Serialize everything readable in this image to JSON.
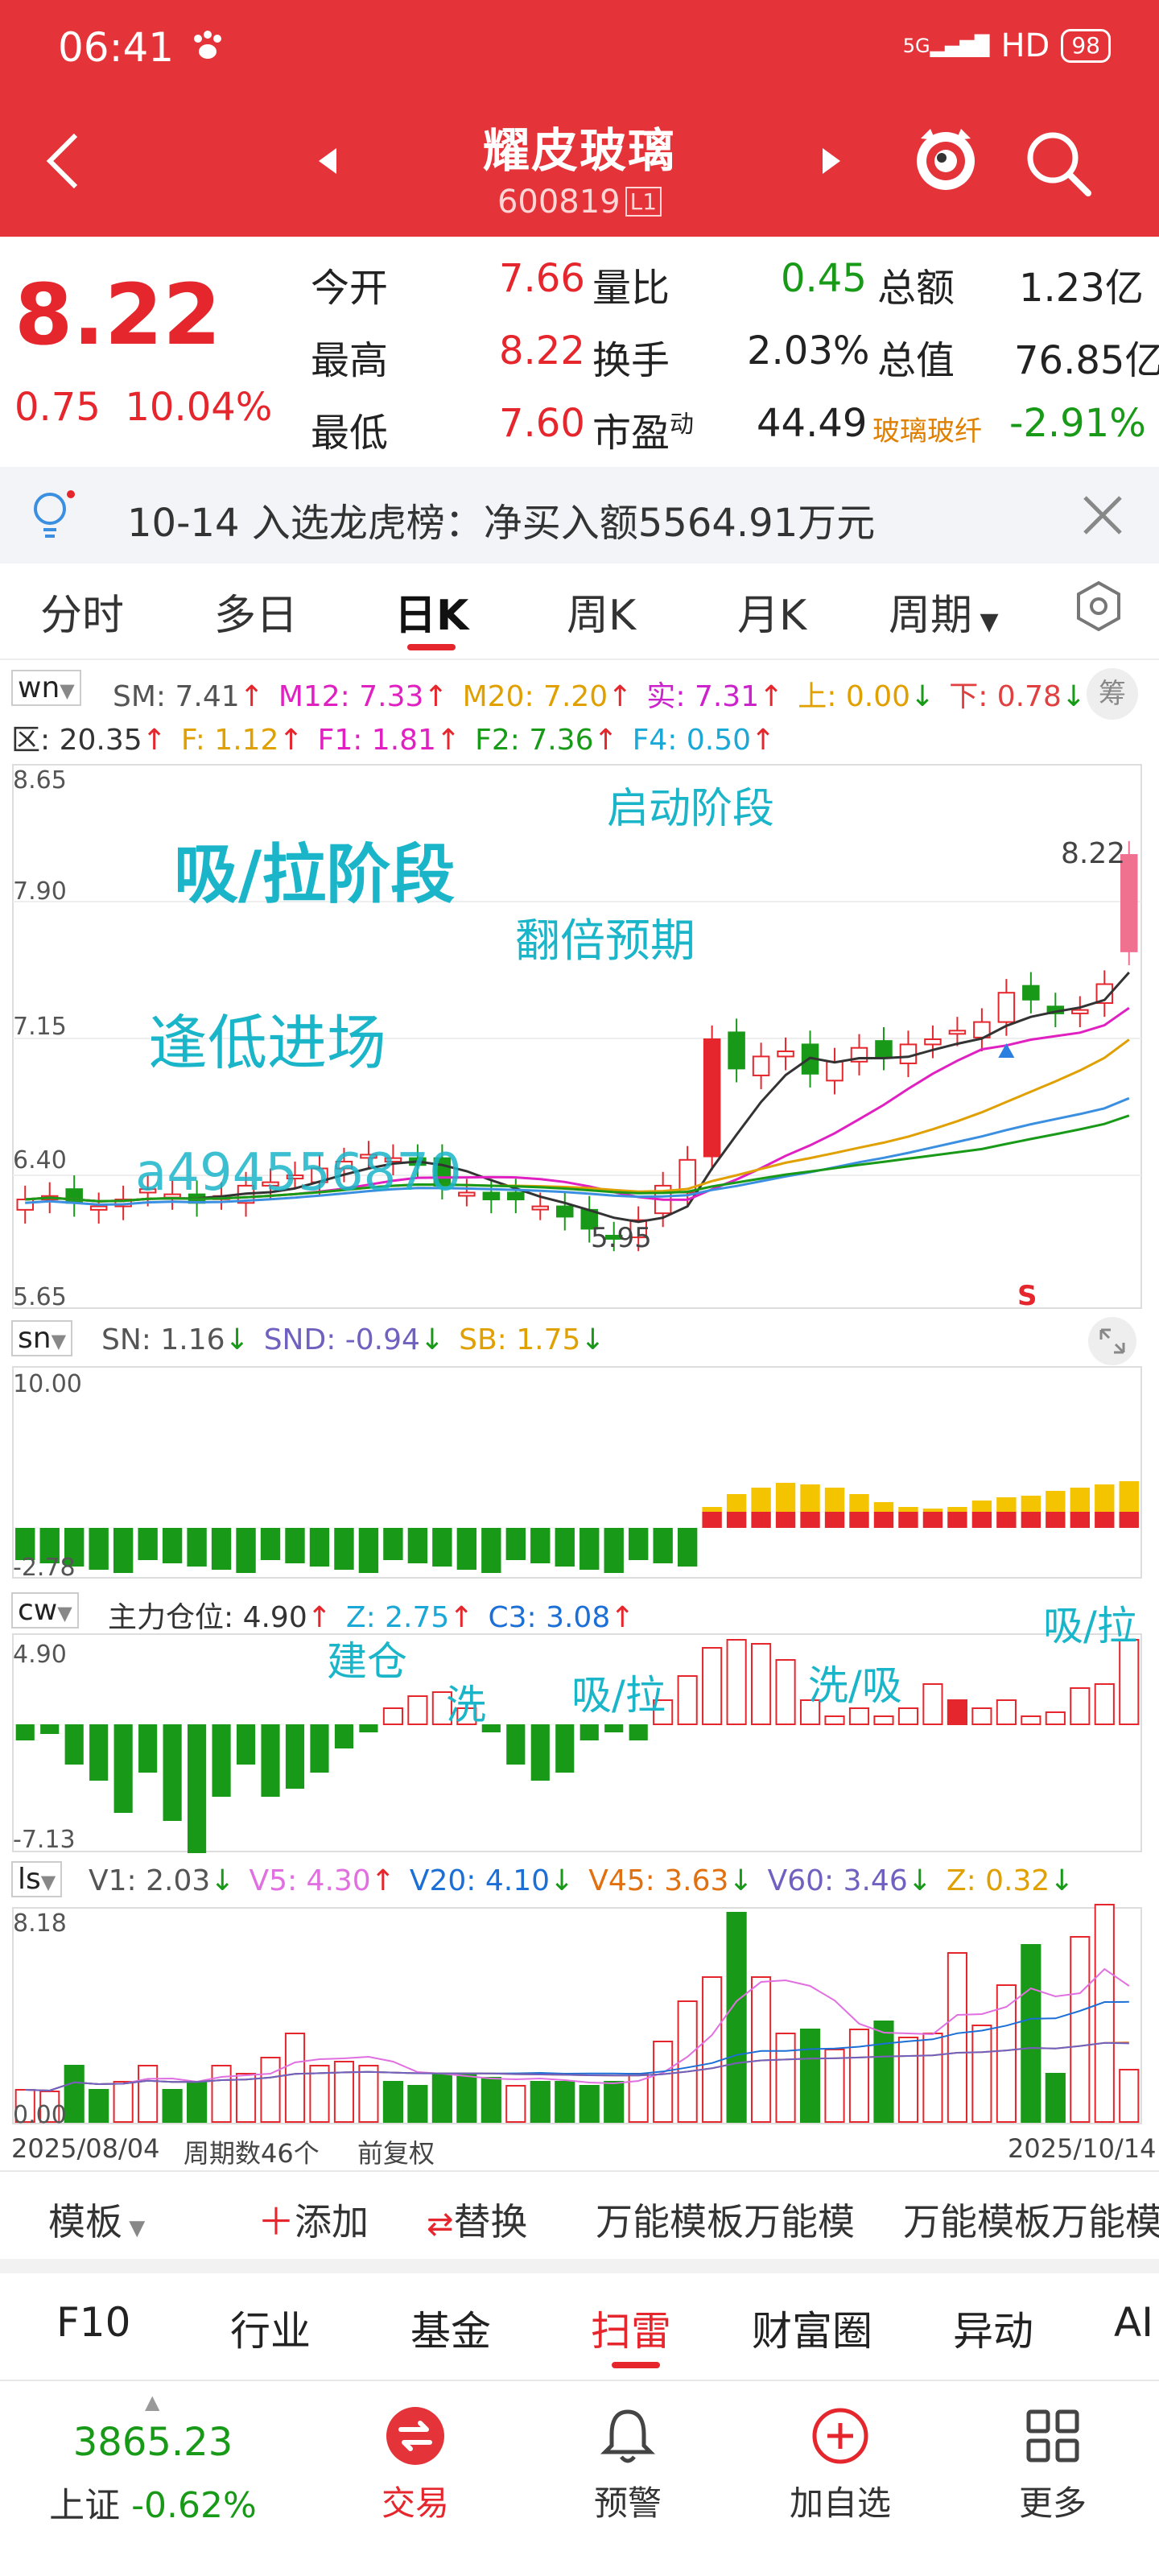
{
  "status_bar": {
    "time": "06:41",
    "network": "5G",
    "hd": "HD",
    "battery": "98"
  },
  "header": {
    "title": "耀皮玻璃",
    "code": "600819",
    "code_badge": "L1"
  },
  "quote": {
    "price": "8.22",
    "change": "0.75",
    "change_pct": "10.04%",
    "rows": [
      {
        "l1": "今开",
        "v1": "7.66",
        "l2": "量比",
        "v2": "0.45",
        "l3": "总额",
        "v3": "1.23亿"
      },
      {
        "l1": "最高",
        "v1": "8.22",
        "l2": "换手",
        "v2": "2.03%",
        "l3": "总值",
        "v3": "76.85亿"
      },
      {
        "l1": "最低",
        "v1": "7.60",
        "l2": "市盈",
        "l2_sup": "动",
        "v2": "44.49",
        "l3": "玻璃玻纤",
        "v3": "-2.91%"
      }
    ]
  },
  "notice": {
    "text": "10-14 入选龙虎榜：净买入额5564.91万元"
  },
  "tabs": [
    "分时",
    "多日",
    "日K",
    "周K",
    "月K",
    "周期"
  ],
  "tab_active": "日K",
  "kline_panel": {
    "indicator": "wn",
    "chip_label": "筹",
    "line1": [
      {
        "t": "SM: 7.41",
        "arrow": "↑",
        "color": "#555555"
      },
      {
        "t": "M12: 7.33",
        "arrow": "↑",
        "color": "#e020c0"
      },
      {
        "t": "M20: 7.20",
        "arrow": "↑",
        "color": "#e0a000"
      },
      {
        "t": "实: 7.31",
        "arrow": "↑",
        "color": "#cc22cc"
      },
      {
        "t": "上: 0.00",
        "arrow": "↓",
        "color": "#e0a000"
      },
      {
        "t": "下: 0.78",
        "arrow": "↓",
        "color": "#e04040"
      }
    ],
    "line2": [
      {
        "t": "区: 20.35",
        "arrow": "↑",
        "color": "#333333"
      },
      {
        "t": "F: 1.12",
        "arrow": "↑",
        "color": "#e0a000"
      },
      {
        "t": "F1: 1.81",
        "arrow": "↑",
        "color": "#e020c0"
      },
      {
        "t": "F2: 7.36",
        "arrow": "↑",
        "color": "#189a18"
      },
      {
        "t": "F4: 0.50",
        "arrow": "↑",
        "color": "#1ba8d6"
      }
    ],
    "axis": [
      "8.65",
      "7.90",
      "7.15",
      "6.40",
      "5.65"
    ],
    "ann_qidong": "启动阶段",
    "ann_xila": "吸/拉阶段",
    "ann_fanbei": "翻倍预期",
    "ann_fengdi": "逢低进场",
    "watermark": "a494556870",
    "high_label": "8.22",
    "low_label": "5.95",
    "s_mark": "S"
  },
  "sn_panel": {
    "indicator": "sn",
    "line": [
      {
        "t": "SN: 1.16",
        "arrow": "↓",
        "color": "#555555"
      },
      {
        "t": "SND: -0.94",
        "arrow": "↓",
        "color": "#7060c0"
      },
      {
        "t": "SB: 1.75",
        "arrow": "↓",
        "color": "#e0a000"
      }
    ],
    "axis_top": "10.00",
    "axis_bottom": "-2.78"
  },
  "cw_panel": {
    "indicator": "cw",
    "line": [
      {
        "t": "主力仓位: 4.90",
        "arrow": "↑",
        "color": "#333333"
      },
      {
        "t": "Z: 2.75",
        "arrow": "↑",
        "color": "#1ba8d6"
      },
      {
        "t": "C3: 3.08",
        "arrow": "↑",
        "color": "#1b6fd6"
      }
    ],
    "axis_top": "4.90",
    "axis_bottom": "-7.13",
    "ann_jiancang": "建仓",
    "ann_xi": "洗",
    "ann_xila": "吸/拉",
    "ann_xixi": "洗/吸",
    "ann_xila2": "吸/拉"
  },
  "ls_panel": {
    "indicator": "ls",
    "line": [
      {
        "t": "V1: 2.03",
        "arrow": "↓",
        "color": "#555555"
      },
      {
        "t": "V5: 4.30",
        "arrow": "↑",
        "color": "#e070e0"
      },
      {
        "t": "V20: 4.10",
        "arrow": "↓",
        "color": "#1b6fd6"
      },
      {
        "t": "V45: 3.63",
        "arrow": "↓",
        "color": "#e07010"
      },
      {
        "t": "V60: 3.46",
        "arrow": "↓",
        "color": "#7060c0"
      },
      {
        "t": "Z: 0.32",
        "arrow": "↓",
        "color": "#e0a000"
      }
    ],
    "axis_top": "8.18",
    "axis_bottom": "0.00"
  },
  "date_bar": {
    "start": "2025/08/04",
    "count": "周期数46个",
    "adjust": "前复权",
    "end": "2025/10/14"
  },
  "template_bar": {
    "template": "模板",
    "add": "添加",
    "replace": "替换",
    "t1": "万能模板万能模",
    "t2": "万能模板万能模"
  },
  "nav_tabs": [
    "F10",
    "行业",
    "基金",
    "扫雷",
    "财富圈",
    "异动",
    "AI"
  ],
  "nav_active": "扫雷",
  "bottom": {
    "index_value": "3865.23",
    "index_name": "上证",
    "index_change": "-0.62%",
    "trade": "交易",
    "alert": "预警",
    "add": "加自选",
    "more": "更多"
  }
}
